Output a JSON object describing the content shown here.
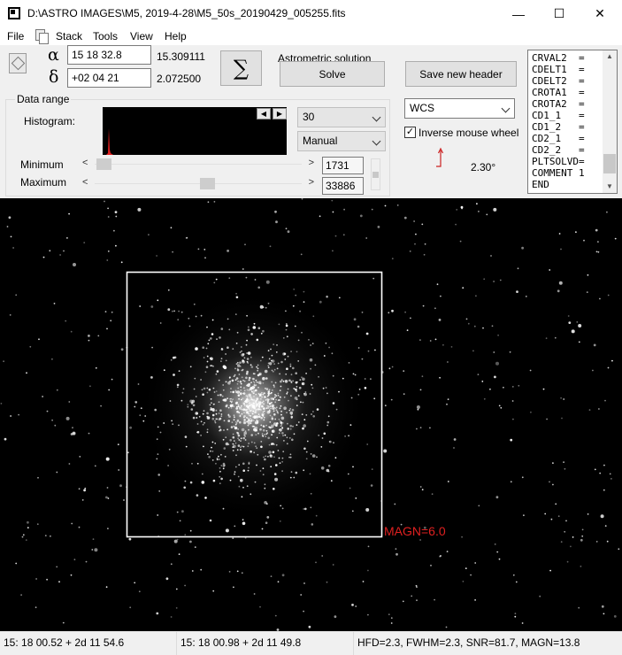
{
  "window": {
    "title": "D:\\ASTRO IMAGES\\M5, 2019-4-28\\M5_50s_20190429_005255.fits",
    "min_glyph": "—",
    "max_glyph": "☐",
    "close_glyph": "✕"
  },
  "menu": {
    "items": [
      "File",
      "Stack",
      "Tools",
      "View",
      "Help"
    ]
  },
  "coords": {
    "alpha_symbol": "α",
    "delta_symbol": "δ",
    "ra_input": "15 18 32.8",
    "dec_input": "+02 04 21",
    "ra_value": "15.309111",
    "dec_value": "2.072500"
  },
  "sum_button": {
    "label": "∑"
  },
  "astrometry": {
    "group_title": "Astrometric solution",
    "solve_label": "Solve",
    "save_header_label": "Save new header"
  },
  "data_range": {
    "group_title": "Data range",
    "histogram_label": "Histogram:",
    "left_arrow": "◀",
    "right_arrow": "▶",
    "bins_select": "30",
    "mode_select": "Manual",
    "minimum_label": "Minimum",
    "maximum_label": "Maximum",
    "minimum_value": "1731",
    "maximum_value": "33886",
    "min_slider_level": 0.01,
    "max_slider_level": 0.55
  },
  "wcs": {
    "select": "WCS",
    "inverse_mouse_wheel_label": "Inverse mouse wheel",
    "inverse_checked_glyph": "✓",
    "rotation_text": "2.30°"
  },
  "fits_header": {
    "lines": [
      "CRVAL2  =",
      "CDELT1  =",
      "CDELT2  =",
      "CROTA1  =",
      "CROTA2  =",
      "CD1_1   =",
      "CD1_2   =",
      "CD2_1   =",
      "CD2_2   =",
      "PLTSOLVD=",
      "COMMENT 1",
      "END"
    ],
    "scroll_up": "▲",
    "scroll_down": "▼"
  },
  "image": {
    "magnitude_label": "MAGN=6.0",
    "annotation_color": "#e02020",
    "background": "#000000"
  },
  "statusbar": {
    "cursor_coords": "15: 18  00.52   + 2d 11  54.6",
    "center_coords": "15: 18  00.98   + 2d 11  49.8",
    "measurement": "HFD=2.3, FWHM=2.3, SNR=81.7, MAGN=13.8"
  },
  "colors": {
    "histogram_spike": "#e02020",
    "north_arrow": "#cc2222"
  }
}
